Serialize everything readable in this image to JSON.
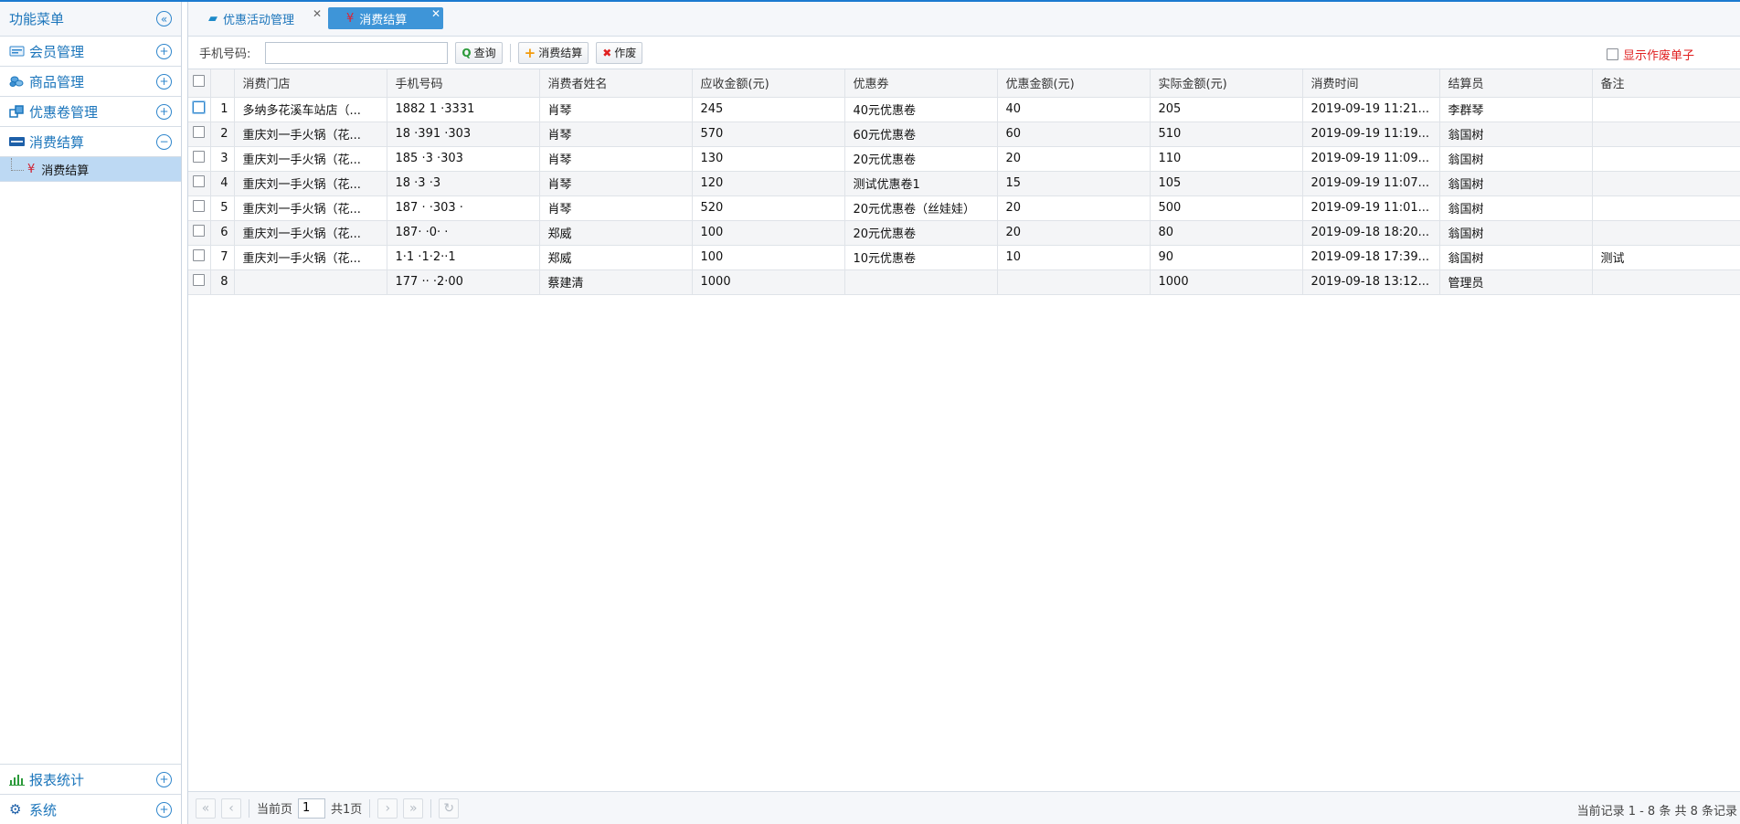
{
  "sidebar": {
    "title": "功能菜单",
    "collapse_icon": "double-chevron-left-icon",
    "groups": [
      {
        "label": "会员管理",
        "icon": "member-card-icon",
        "state": "collapsed"
      },
      {
        "label": "商品管理",
        "icon": "coins-icon",
        "state": "collapsed"
      },
      {
        "label": "优惠卷管理",
        "icon": "coupon-icon",
        "state": "collapsed"
      },
      {
        "label": "消费结算",
        "icon": "paypal-icon",
        "state": "expanded"
      }
    ],
    "subitem": {
      "label": "消费结算",
      "icon": "yen-icon"
    },
    "bottom_groups": [
      {
        "label": "报表统计",
        "icon": "bar-chart-icon"
      },
      {
        "label": "系统",
        "icon": "gear-icon"
      }
    ]
  },
  "tabs": [
    {
      "label": "优惠活动管理",
      "icon": "book-icon",
      "active": false
    },
    {
      "label": "消费结算",
      "icon": "yen-icon",
      "active": true
    }
  ],
  "toolbar": {
    "phone_label": "手机号码:",
    "phone_value": "",
    "search_label": "查询",
    "settle_label": "消费结算",
    "void_label": "作废",
    "show_void_label": "显示作废单子"
  },
  "grid": {
    "columns": [
      "消费门店",
      "手机号码",
      "消费者姓名",
      "应收金额(元)",
      "优惠券",
      "优惠金额(元)",
      "实际金额(元)",
      "消费时间",
      "结算员",
      "备注"
    ],
    "rows": [
      {
        "no": "1",
        "store": "多纳多花溪车站店（...",
        "phone": "1882 1  ·3331",
        "name": "肖琴",
        "due": "245",
        "coupon": "40元优惠卷",
        "discount": "40",
        "actual": "205",
        "time": "2019-09-19 11:21...",
        "cashier": "李群琴",
        "note": ""
      },
      {
        "no": "2",
        "store": "重庆刘一手火锅（花...",
        "phone": "18 ·391   ·303",
        "name": "肖琴",
        "due": "570",
        "coupon": "60元优惠卷",
        "discount": "60",
        "actual": "510",
        "time": "2019-09-19 11:19...",
        "cashier": "翁国树",
        "note": ""
      },
      {
        "no": "3",
        "store": "重庆刘一手火锅（花...",
        "phone": "185  ·3  ·303",
        "name": "肖琴",
        "due": "130",
        "coupon": "20元优惠卷",
        "discount": "20",
        "actual": "110",
        "time": "2019-09-19 11:09...",
        "cashier": "翁国树",
        "note": ""
      },
      {
        "no": "4",
        "store": "重庆刘一手火锅（花...",
        "phone": "18    ·3  ·3",
        "name": "肖琴",
        "due": "120",
        "coupon": "测试优惠卷1",
        "discount": "15",
        "actual": "105",
        "time": "2019-09-19 11:07...",
        "cashier": "翁国树",
        "note": ""
      },
      {
        "no": "5",
        "store": "重庆刘一手火锅（花...",
        "phone": "187 ·  ·303 ·",
        "name": "肖琴",
        "due": "520",
        "coupon": "20元优惠卷（丝娃娃）",
        "discount": "20",
        "actual": "500",
        "time": "2019-09-19 11:01...",
        "cashier": "翁国树",
        "note": ""
      },
      {
        "no": "6",
        "store": "重庆刘一手火锅（花...",
        "phone": "187·    ·0· ·",
        "name": "郑威",
        "due": "100",
        "coupon": "20元优惠卷",
        "discount": "20",
        "actual": "80",
        "time": "2019-09-18 18:20...",
        "cashier": "翁国树",
        "note": ""
      },
      {
        "no": "7",
        "store": "重庆刘一手火锅（花...",
        "phone": "1·1  ·1·2··1",
        "name": "郑威",
        "due": "100",
        "coupon": "10元优惠卷",
        "discount": "10",
        "actual": "90",
        "time": "2019-09-18 17:39...",
        "cashier": "翁国树",
        "note": "测试"
      },
      {
        "no": "8",
        "store": "",
        "phone": "177  ·· ·2·00",
        "name": "蔡建清",
        "due": "1000",
        "coupon": "",
        "discount": "",
        "actual": "1000",
        "time": "2019-09-18 13:12...",
        "cashier": "管理员",
        "note": ""
      }
    ]
  },
  "pager": {
    "current_label": "当前页",
    "page_value": "1",
    "total_pages": "共1页",
    "info": "当前记录 1 - 8 条 共 8 条记录"
  },
  "colors": {
    "accent": "#1b7ad0",
    "tab_active": "#3e95d8",
    "selected_row": "#bdd9f3",
    "void_text": "#e02020"
  }
}
